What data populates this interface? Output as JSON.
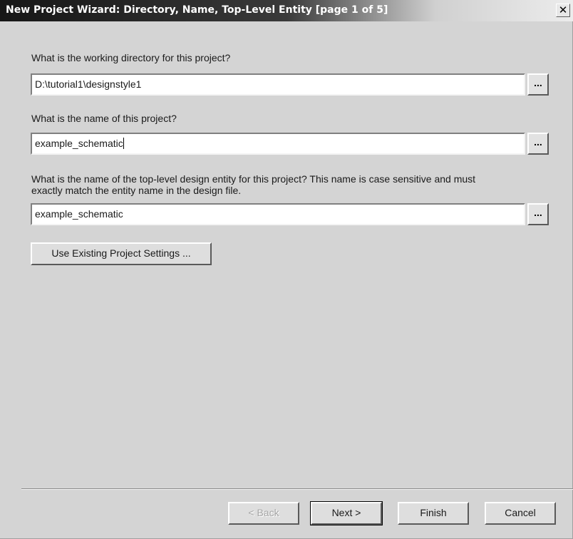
{
  "window": {
    "title": "New Project Wizard: Directory, Name, Top-Level Entity [page 1 of 5]",
    "close_glyph": "✕"
  },
  "directory": {
    "question": "What is the working directory for this project?",
    "value": "D:\\tutorial1\\designstyle1",
    "browse_label": "..."
  },
  "project_name": {
    "question": "What is the name of this project?",
    "value": "example_schematic",
    "browse_label": "..."
  },
  "top_entity": {
    "question_line1": "What is the name of the top-level design entity for this project? This name is case sensitive and must",
    "question_line2": "exactly match the entity name in the design file.",
    "value": "example_schematic",
    "browse_label": "..."
  },
  "use_existing_label": "Use Existing Project Settings ...",
  "footer": {
    "back_label": "< Back",
    "next_label": "Next >",
    "finish_label": "Finish",
    "cancel_label": "Cancel"
  }
}
